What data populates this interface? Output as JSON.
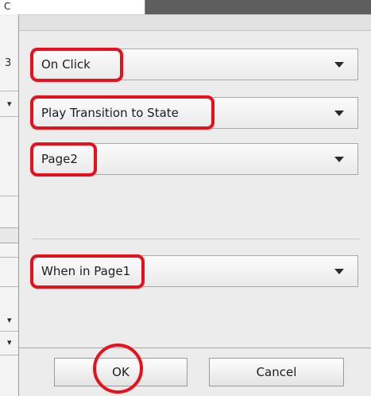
{
  "background_app": {
    "top_glyph": "C",
    "left_glyphs": [
      "3",
      "▾",
      "▾",
      "▾"
    ]
  },
  "dialog": {
    "trigger_select": {
      "value": "On Click"
    },
    "action_select": {
      "value": "Play Transition to State"
    },
    "target_state_select": {
      "value": "Page2"
    },
    "condition_select": {
      "value": "When in Page1"
    },
    "buttons": {
      "ok_label": "OK",
      "cancel_label": "Cancel"
    }
  },
  "annotation_color": "#e8101a"
}
